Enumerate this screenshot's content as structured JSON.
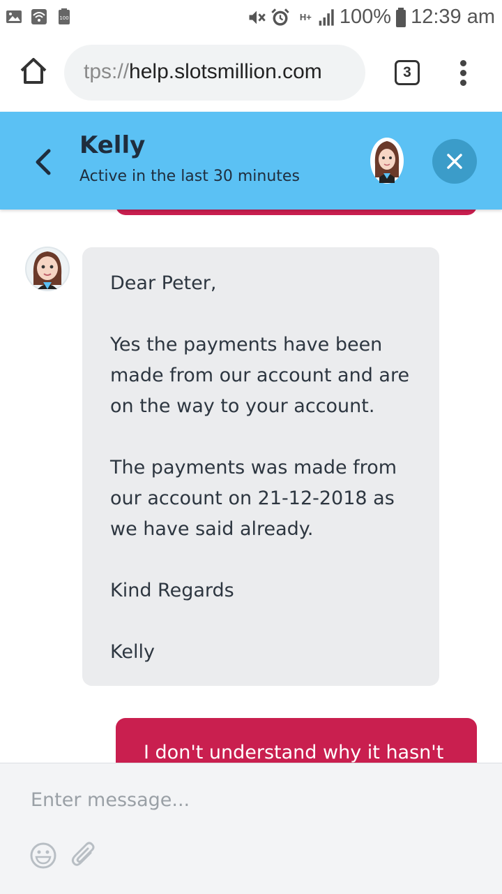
{
  "status_bar": {
    "battery_percent": "100%",
    "time": "12:39 am",
    "network_label": "H+",
    "left_icons": [
      "image-icon",
      "wifi-icon",
      "battery-saver-icon"
    ],
    "right_icons": [
      "mute-icon",
      "alarm-icon",
      "data-icon",
      "signal-icon",
      "battery-icon"
    ]
  },
  "browser": {
    "url_scheme": "tps://",
    "url_host": "help.slotsmillion.com",
    "tab_count": "3",
    "icons": [
      "home-icon",
      "tabs-icon",
      "more-vert-icon"
    ]
  },
  "chat_header": {
    "agent_name": "Kelly",
    "agent_status": "Active in the last 30 minutes",
    "color": "#5bc1f4",
    "close_color": "#3b9cc9",
    "icons": [
      "back-chevron-icon",
      "agent-avatar",
      "close-icon"
    ]
  },
  "messages": [
    {
      "sender": "agent",
      "paragraphs": [
        "Dear Peter,",
        "Yes the payments have been made from our account and are on the way to your account.",
        "The payments was made from our account on 21-12-2018 as we have said already.",
        "Kind Regards",
        "Kelly"
      ],
      "bubble_color": "#ebecee"
    },
    {
      "sender": "user",
      "text": "I don't understand why it hasn't",
      "bubble_color": "#c91f4f"
    }
  ],
  "composer": {
    "placeholder": "Enter message...",
    "icons": [
      "emoji-icon",
      "attachment-icon"
    ]
  }
}
